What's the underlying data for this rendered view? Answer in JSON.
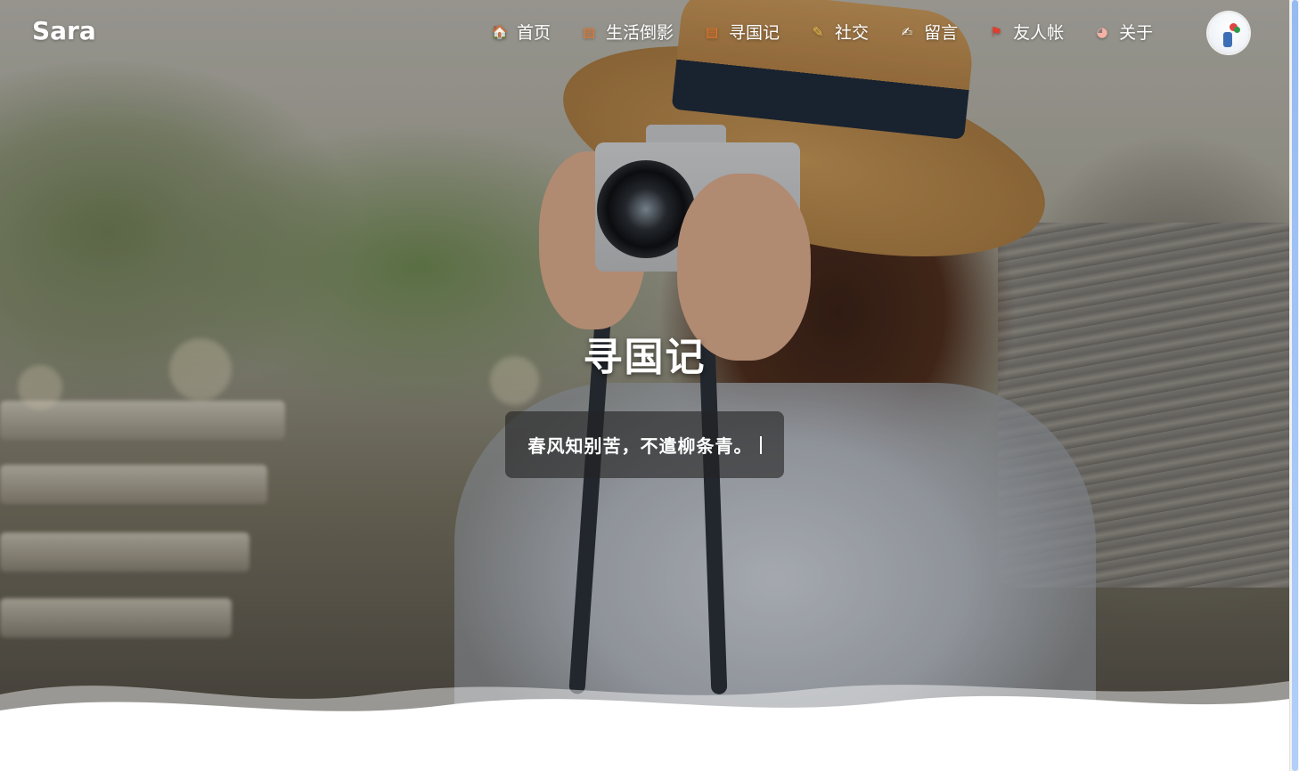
{
  "site": {
    "logo": "Sara"
  },
  "nav": {
    "items": [
      {
        "label": "首页",
        "icon": "home-icon",
        "glyph": "🏠",
        "color": "#f5a623"
      },
      {
        "label": "生活倒影",
        "icon": "document-icon",
        "glyph": "▤",
        "color": "#f07a2a"
      },
      {
        "label": "寻国记",
        "icon": "document-icon",
        "glyph": "▤",
        "color": "#f07a2a"
      },
      {
        "label": "社交",
        "icon": "pencil-icon",
        "glyph": "✎",
        "color": "#e8c24a"
      },
      {
        "label": "留言",
        "icon": "write-icon",
        "glyph": "✍",
        "color": "#ffffff"
      },
      {
        "label": "友人帐",
        "icon": "flag-icon",
        "glyph": "⚑",
        "color": "#e23c2d"
      },
      {
        "label": "关于",
        "icon": "pig-face-icon",
        "glyph": "◕",
        "color": "#f4b1a5"
      }
    ]
  },
  "hero": {
    "title": "寻国记",
    "motto": "春风知别苦，不遣柳条青。"
  },
  "colors": {
    "accent": "#4a8ef0",
    "motto_bg": "#232323"
  }
}
